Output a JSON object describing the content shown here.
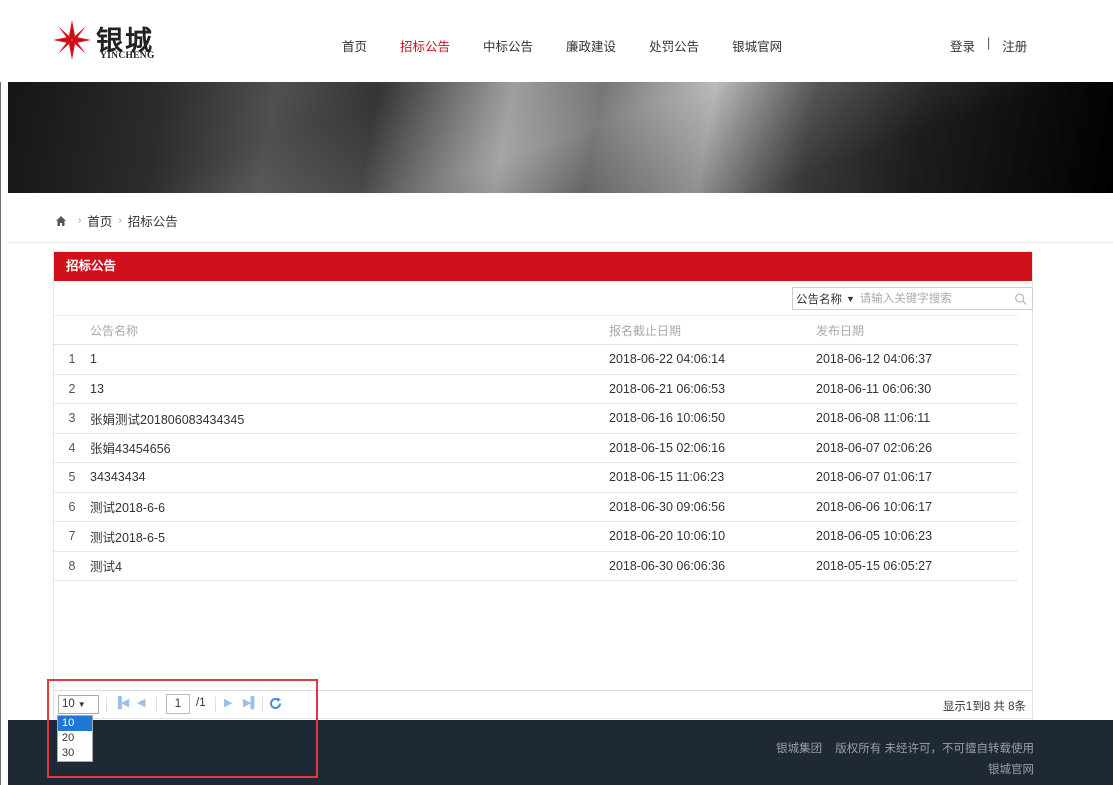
{
  "logo": {
    "name_cn": "银城",
    "name_en": "YINCHENG"
  },
  "nav": [
    {
      "label": "首页",
      "active": false
    },
    {
      "label": "招标公告",
      "active": true
    },
    {
      "label": "中标公告",
      "active": false
    },
    {
      "label": "廉政建设",
      "active": false
    },
    {
      "label": "处罚公告",
      "active": false
    },
    {
      "label": "银城官网",
      "active": false
    }
  ],
  "auth": {
    "login": "登录",
    "separator": "|",
    "register": "注册"
  },
  "breadcrumb": {
    "home_icon": "home-icon",
    "items": [
      "首页",
      "招标公告"
    ]
  },
  "panel": {
    "title": "招标公告"
  },
  "search": {
    "field_label": "公告名称",
    "placeholder": "请输入关键字搜索",
    "icon": "search-icon"
  },
  "table": {
    "headers": {
      "name": "公告名称",
      "deadline": "报名截止日期",
      "published": "发布日期"
    },
    "rows": [
      {
        "idx": "1",
        "name": "1",
        "deadline": "2018-06-22 04:06:14",
        "published": "2018-06-12 04:06:37"
      },
      {
        "idx": "2",
        "name": "13",
        "deadline": "2018-06-21 06:06:53",
        "published": "2018-06-11 06:06:30"
      },
      {
        "idx": "3",
        "name": "张娟测试201806083434345",
        "deadline": "2018-06-16 10:06:50",
        "published": "2018-06-08 11:06:11"
      },
      {
        "idx": "4",
        "name": "张娟43454656",
        "deadline": "2018-06-15 02:06:16",
        "published": "2018-06-07 02:06:26"
      },
      {
        "idx": "5",
        "name": "34343434",
        "deadline": "2018-06-15 11:06:23",
        "published": "2018-06-07 01:06:17"
      },
      {
        "idx": "6",
        "name": "测试2018-6-6",
        "deadline": "2018-06-30 09:06:56",
        "published": "2018-06-06 10:06:17"
      },
      {
        "idx": "7",
        "name": "测试2018-6-5",
        "deadline": "2018-06-20 10:06:10",
        "published": "2018-06-05 10:06:23"
      },
      {
        "idx": "8",
        "name": "测试4",
        "deadline": "2018-06-30 06:06:36",
        "published": "2018-05-15 06:05:27"
      }
    ]
  },
  "pager": {
    "page_size": "10",
    "page_size_options": [
      "10",
      "20",
      "30"
    ],
    "current_page": "1",
    "total_pages": "/1",
    "info": "显示1到8 共 8条"
  },
  "footer": {
    "company": "银城集团",
    "copyright": "版权所有 未经许可，不可擅自转载使用",
    "site_link": "银城官网"
  },
  "colors": {
    "brand_red": "#d0111b",
    "footer_bg": "#1f2835",
    "annotation": "#e23a3a",
    "pager_icons": "#9cc0e6"
  }
}
